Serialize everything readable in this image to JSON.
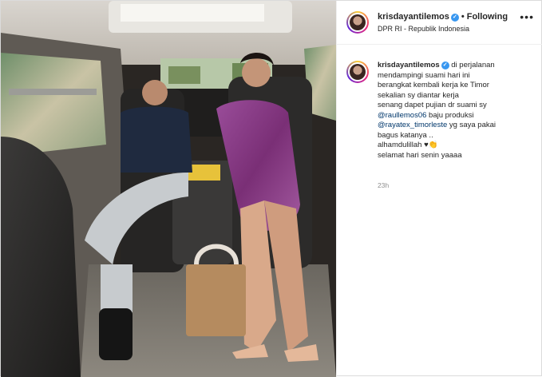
{
  "post": {
    "username": "krisdayantilemos",
    "verified": true,
    "follow_label": "Following",
    "location": "DPR RI - Republik Indonesia",
    "caption_username": "krisdayantilemos",
    "caption_lines": [
      "di perjalanan",
      "mendampingi suami hari ini",
      "berangkat kembali kerja ke Timor",
      "sekalian sy diantar kerja",
      "senang dapet pujian dr suami sy"
    ],
    "mention_1": "@raullemos06",
    "after_mention_1": " baju produksi",
    "mention_2": "@rayatex_timorleste",
    "after_mention_2": " yg saya pakai",
    "caption_lines_2": [
      "bagus katanya ..",
      "alhamdulillah ♥👏"
    ],
    "caption_last": "selamat hari senin yaaaa",
    "time_ago": "23h",
    "more_icon": "ellipsis-icon",
    "verified_icon": "verified-badge-icon"
  },
  "colors": {
    "mention": "#00376b",
    "verified": "#3897f0",
    "muted": "#8e8e8e"
  }
}
